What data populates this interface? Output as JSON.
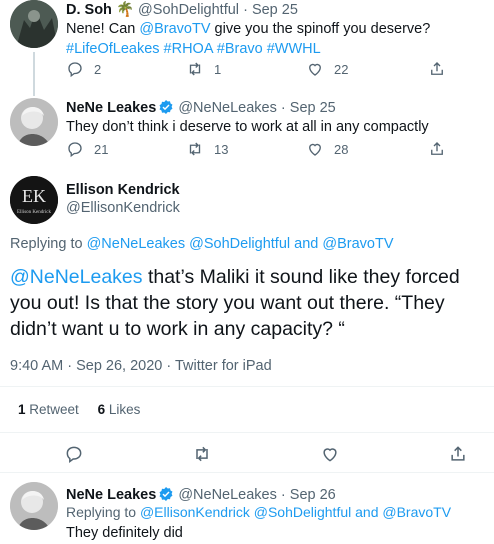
{
  "tweet1": {
    "name": "D. Soh",
    "emoji": "🌴",
    "handle": "@SohDelightful",
    "time": "Sep 25",
    "text_prefix": "Nene! Can ",
    "mention": "@BravoTV",
    "text_mid": " give you the spinoff you deserve? ",
    "hashtag1": "#LifeOfLeakes",
    "hashtag2": "#RHOA",
    "hashtag3": "#Bravo",
    "hashtag4": "#WWHL",
    "replies": "2",
    "retweets": "1",
    "likes": "22"
  },
  "tweet2": {
    "name": "NeNe Leakes",
    "handle": "@NeNeLeakes",
    "time": "Sep 25",
    "text": "They don’t think i deserve to work at all in any compactly",
    "replies": "21",
    "retweets": "13",
    "likes": "28"
  },
  "main_tweet": {
    "name": "Ellison Kendrick",
    "handle": "@EllisonKendrick",
    "avatar_letters": "EK",
    "avatar_caption": "Ellison Kendrick",
    "replying_to_label": "Replying to",
    "replying_mentions": "@NeNeLeakes @SohDelightful and @BravoTV",
    "mention": "@NeNeLeakes",
    "text": " that’s Maliki it sound like they forced you out! Is that the story you want out there.  “They didn’t want u to work in any capacity? “",
    "timestamp": "9:40 AM · Sep 26, 2020 · Twitter for iPad",
    "retweet_count": "1",
    "retweet_label": "Retweet",
    "like_count": "6",
    "like_label": "Likes"
  },
  "tweet4": {
    "name": "NeNe Leakes",
    "handle": "@NeNeLeakes",
    "time": "Sep 26",
    "replying_to_label": "Replying to",
    "replying_mentions": "@EllisonKendrick @SohDelightful and @BravoTV",
    "text": "They definitely did"
  },
  "separator": "·",
  "colors": {
    "link": "#1d9bf0",
    "muted": "#536471",
    "verified": "#1d9bf0"
  }
}
